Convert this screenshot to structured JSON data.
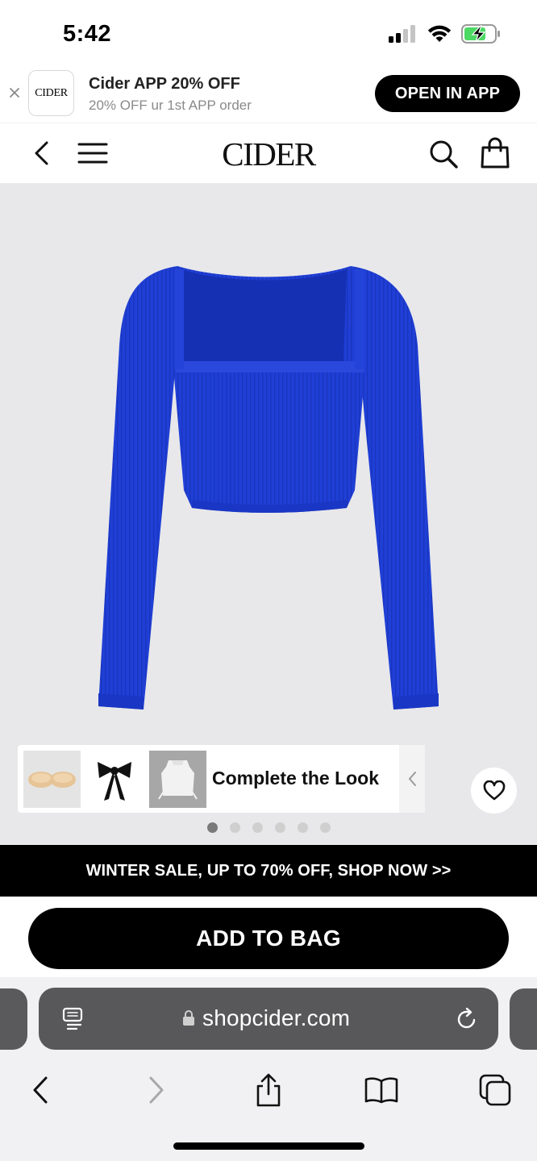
{
  "status_bar": {
    "time": "5:42",
    "icons": [
      "signal-icon",
      "wifi-icon",
      "battery-charging-icon"
    ],
    "battery_color": "#4cd964"
  },
  "app_banner": {
    "close_icon": "close-icon",
    "logo_text": "CIDER",
    "title": "Cider APP 20% OFF",
    "subtitle": "20% OFF ur 1st APP order",
    "open_button": "OPEN IN APP"
  },
  "header": {
    "logo": "CIDER",
    "icons": [
      "back-chevron-icon",
      "menu-icon",
      "search-icon",
      "shopping-bag-icon"
    ]
  },
  "product": {
    "image": "blue-ribbed-square-neck-long-sleeve-crop-top",
    "product_color": "#1f3fd6",
    "complete_the_look": {
      "label": "Complete the Look",
      "thumbnails": [
        "nude-adhesive-bra",
        "black-hair-bow",
        "white-knit-sweater-vest"
      ]
    },
    "image_dots": {
      "count": 6,
      "active_index": 0
    }
  },
  "sale_banner": {
    "text": "WINTER SALE, UP TO 70% OFF, SHOP NOW >>"
  },
  "actions": {
    "add_to_bag": "ADD TO BAG"
  },
  "browser": {
    "url": "shopcider.com",
    "icons": [
      "reader-icon",
      "lock-icon",
      "reload-icon",
      "back-icon",
      "forward-icon",
      "share-icon",
      "bookmarks-icon",
      "tabs-icon"
    ]
  }
}
